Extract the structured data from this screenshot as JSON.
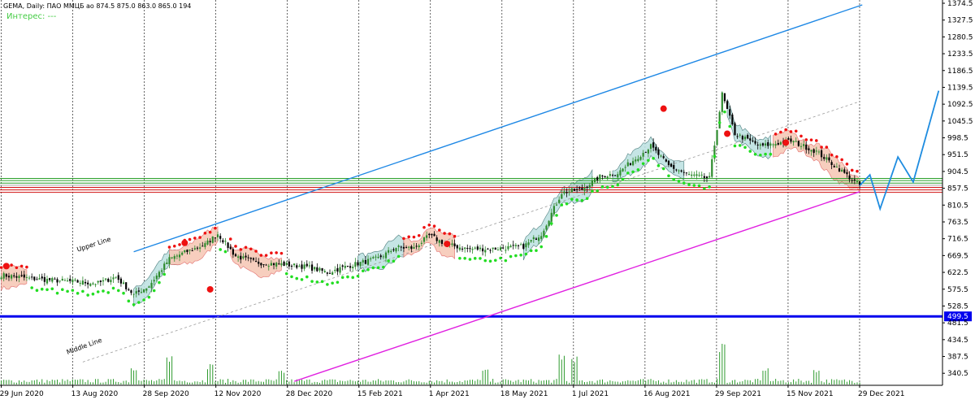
{
  "header": {
    "info_line": "GEMA, Daily:  ПАО ММЦБ ао  874.5 875.0 863.0 865.0  194",
    "interest_label": "Интерес: ---"
  },
  "colors": {
    "background": "#ffffff",
    "grid": "#000000",
    "bull_candle": "#2e8b2e",
    "bear_candle": "#000000",
    "channel_upper": "#1e88e5",
    "channel_lower": "#e020e0",
    "midline": "#9a9a9a",
    "support_line": "#0000ee",
    "red_level": "#d01010",
    "green_level": "#2aa02a",
    "cloud_bull": "#bfe3e3",
    "cloud_bear": "#f7c9b8",
    "stop_dots_red": "#ee1111",
    "stop_dots_green": "#22dd22",
    "forecast": "#1e8ce0",
    "volume": "#2e9a2e",
    "price_tag_bg": "#0000ee"
  },
  "chart_data": {
    "type": "candlestick",
    "title": "GEMA, Daily",
    "ylim": [
      316.0,
      1374.5
    ],
    "y_ticks": [
      1374.5,
      1327.5,
      1280.5,
      1233.5,
      1186.5,
      1139.5,
      1092.5,
      1045.5,
      998.5,
      951.5,
      904.5,
      857.5,
      810.5,
      763.5,
      716.5,
      669.5,
      622.5,
      575.5,
      528.5,
      481.5,
      434.5,
      387.5,
      340.5
    ],
    "y_tick_labels": [
      "1374.5",
      "1327.5",
      "1280.5",
      "1233.5",
      "1186.5",
      "1139.5",
      "1092.5",
      "1045.5",
      "998.5",
      "951.5",
      "904.5",
      "857.5",
      "810.5",
      "763.5",
      "716.5",
      "669.5",
      "622.5",
      "575.5",
      "528.5",
      "481.5",
      "434.5",
      "387.5",
      "340.5"
    ],
    "x_labels": [
      "29 Jun 2020",
      "13 Aug 2020",
      "28 Sep 2020",
      "12 Nov 2020",
      "28 Dec 2020",
      "15 Feb 2021",
      "1 Apr 2021",
      "18 May 2021",
      "1 Jul 2021",
      "16 Aug 2021",
      "29 Sep 2021",
      "15 Nov 2021",
      "29 Dec 2021"
    ],
    "horizontal_levels": {
      "support": 499.5,
      "support_label": "499.5",
      "green": [
        872,
        879,
        885
      ],
      "red": [
        846,
        853,
        860
      ],
      "gray": [
        866
      ]
    },
    "annotations": [
      "Upper Line",
      "Middle Line"
    ],
    "close_anchors": [
      [
        0,
        615
      ],
      [
        12,
        605
      ],
      [
        25,
        598
      ],
      [
        38,
        592
      ],
      [
        45,
        610
      ],
      [
        52,
        560
      ],
      [
        58,
        585
      ],
      [
        66,
        660
      ],
      [
        72,
        678
      ],
      [
        80,
        700
      ],
      [
        85,
        730
      ],
      [
        92,
        668
      ],
      [
        100,
        650
      ],
      [
        110,
        645
      ],
      [
        120,
        638
      ],
      [
        128,
        622
      ],
      [
        136,
        640
      ],
      [
        148,
        662
      ],
      [
        155,
        692
      ],
      [
        162,
        690
      ],
      [
        168,
        725
      ],
      [
        175,
        700
      ],
      [
        183,
        688
      ],
      [
        192,
        688
      ],
      [
        205,
        695
      ],
      [
        212,
        730
      ],
      [
        220,
        845
      ],
      [
        228,
        855
      ],
      [
        235,
        890
      ],
      [
        242,
        900
      ],
      [
        255,
        975
      ],
      [
        262,
        920
      ],
      [
        270,
        895
      ],
      [
        278,
        885
      ],
      [
        283,
        1120
      ],
      [
        288,
        1010
      ],
      [
        298,
        975
      ],
      [
        310,
        990
      ],
      [
        320,
        960
      ],
      [
        330,
        905
      ],
      [
        337,
        865
      ]
    ],
    "volume_spikes": [
      [
        52,
        0.5
      ],
      [
        66,
        1.0
      ],
      [
        82,
        0.6
      ],
      [
        110,
        0.3
      ],
      [
        190,
        0.35
      ],
      [
        220,
        1.1
      ],
      [
        225,
        0.9
      ],
      [
        283,
        1.5
      ],
      [
        300,
        0.45
      ],
      [
        320,
        0.35
      ]
    ],
    "forecast_path": [
      [
        337,
        865
      ],
      [
        341,
        895
      ],
      [
        345,
        800
      ],
      [
        352,
        945
      ],
      [
        358,
        875
      ],
      [
        368,
        1130
      ]
    ]
  }
}
